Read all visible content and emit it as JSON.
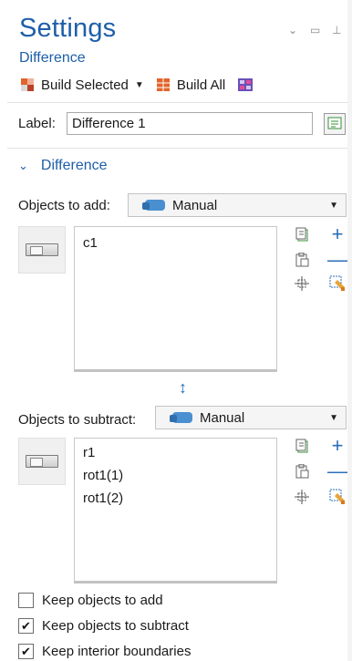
{
  "header": {
    "title": "Settings",
    "subtitle": "Difference",
    "window_controls": {
      "menu": "⌄",
      "maximize": "▭",
      "pin": "⊥"
    },
    "toolbar": {
      "build_selected": "Build Selected",
      "build_all": "Build All"
    }
  },
  "label_row": {
    "label": "Label:",
    "value": "Difference 1"
  },
  "section": {
    "title": "Difference"
  },
  "objects_to_add": {
    "label": "Objects to add:",
    "mode": "Manual",
    "items": [
      "c1"
    ]
  },
  "objects_to_subtract": {
    "label": "Objects to subtract:",
    "mode": "Manual",
    "items": [
      "r1",
      "rot1(1)",
      "rot1(2)"
    ]
  },
  "options": [
    {
      "label": "Keep objects to add",
      "checked": false
    },
    {
      "label": "Keep objects to subtract",
      "checked": true
    },
    {
      "label": "Keep interior boundaries",
      "checked": true
    }
  ],
  "colors": {
    "accent": "#1e5fa8",
    "icon_blue": "#2a6fb8",
    "build_orange": "#e2642c"
  }
}
